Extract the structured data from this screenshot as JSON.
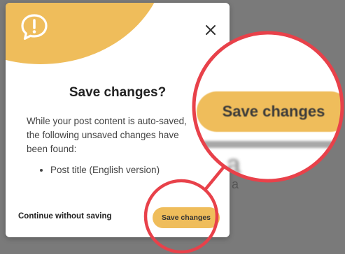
{
  "modal": {
    "title": "Save changes?",
    "message": "While your post content is auto-saved, the following unsaved changes have been found:",
    "changes": [
      "Post title (English version)"
    ],
    "continue_label": "Continue without saving",
    "save_label": "Save changes"
  },
  "zoom": {
    "save_label": "Save changes"
  },
  "icons": {
    "alert": "speech-bubble-exclamation-icon",
    "close": "close-icon"
  },
  "colors": {
    "accent": "#efbd5b",
    "highlight_ring": "#e8414a",
    "backdrop": "#7a7a7a"
  }
}
